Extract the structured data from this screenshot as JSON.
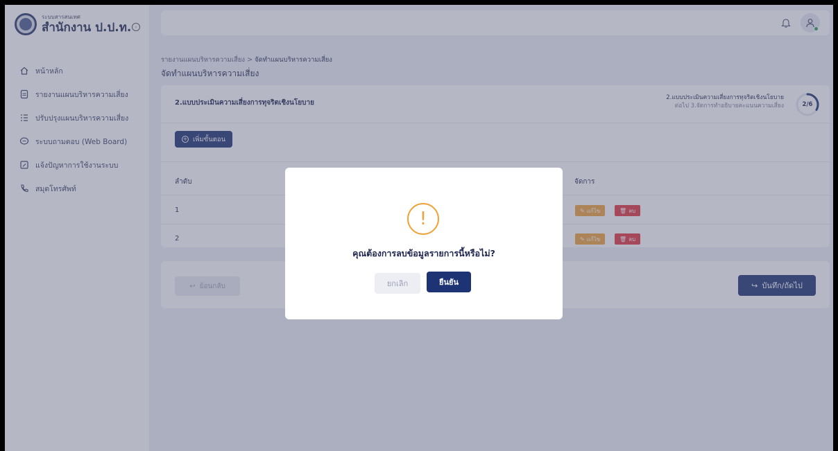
{
  "sidebar": {
    "logo_sub": "ระบบสารสนเทศ",
    "logo_main": "สำนักงาน ป.ป.ท.",
    "items": [
      {
        "label": "หน้าหลัก",
        "icon": "home-icon"
      },
      {
        "label": "รายงานแผนบริหารความเสี่ยง",
        "icon": "document-icon"
      },
      {
        "label": "ปรับปรุงแผนบริหารความเสี่ยง",
        "icon": "list-icon"
      },
      {
        "label": "ระบบถามตอบ (Web Board)",
        "icon": "chat-icon"
      },
      {
        "label": "แจ้งปัญหาการใช้งานระบบ",
        "icon": "edit-icon"
      },
      {
        "label": "สมุดโทรศัพท์",
        "icon": "phone-icon"
      }
    ]
  },
  "breadcrumb": {
    "parent": "รายงานแผนบริหารความเสี่ยง",
    "separator": ">",
    "current": "จัดทำแผนบริหารความเสี่ยง"
  },
  "page": {
    "title": "จัดทำแผนบริหารความเสี่ยง"
  },
  "step": {
    "title": "2.แบบประเมินความเสี่ยงการทุจริตเชิงนโยบาย",
    "current_label": "2.แบบประเมินความเสี่ยงการทุจริตเชิงนโยบาย",
    "next_label": "ต่อไป 3.จัดการทำอธิบายคะแนนความเสี่ยง",
    "counter": "2/6",
    "progress": 0.333
  },
  "toolbar": {
    "add_label": "เพิ่มขั้นตอน"
  },
  "table": {
    "headers": {
      "order": "ลำดับ",
      "actions": "จัดการ"
    },
    "rows": [
      {
        "order": "1",
        "edit_label": "แก้ไข",
        "delete_label": "ลบ"
      },
      {
        "order": "2",
        "edit_label": "แก้ไข",
        "delete_label": "ลบ"
      }
    ]
  },
  "footer": {
    "back_label": "ย้อนกลับ",
    "save_label": "บันทึก/ถัดไป"
  },
  "modal": {
    "message": "คุณต้องการลบข้อมูลรายการนี้หรือไม่?",
    "cancel_label": "ยกเลิก",
    "confirm_label": "ยืนยัน"
  },
  "colors": {
    "primary": "#1e3374",
    "warning": "#f0a23a",
    "danger": "#e2363f",
    "background": "#eef0f6"
  }
}
